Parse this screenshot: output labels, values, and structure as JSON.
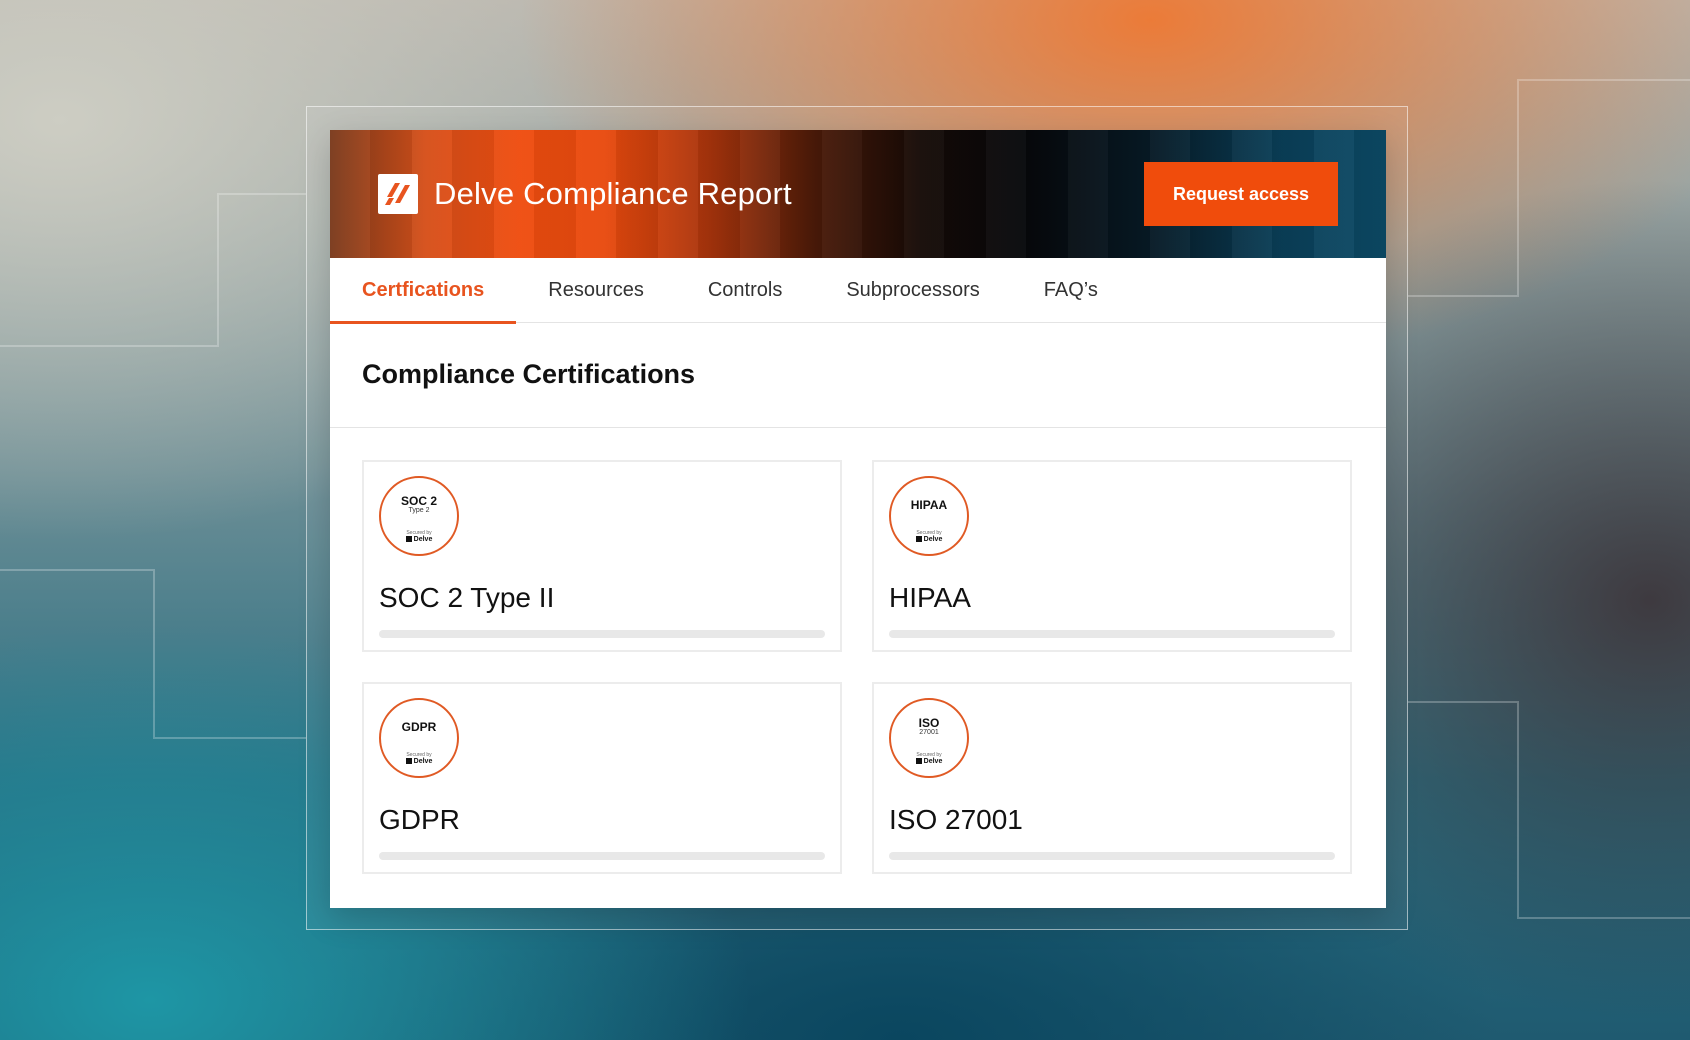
{
  "header": {
    "title": "Delve Compliance Report",
    "request_button": "Request access",
    "logo_icon": "delve-logo-icon"
  },
  "tabs": [
    {
      "label": "Certfications",
      "active": true
    },
    {
      "label": "Resources",
      "active": false
    },
    {
      "label": "Controls",
      "active": false
    },
    {
      "label": "Subprocessors",
      "active": false
    },
    {
      "label": "FAQ’s",
      "active": false
    }
  ],
  "section": {
    "title": "Compliance Certifications"
  },
  "certifications": [
    {
      "name": "SOC 2 Type II",
      "badge_title": "SOC 2",
      "badge_sub": "Type 2",
      "secured_by": "Secured by",
      "brand": "Delve"
    },
    {
      "name": "HIPAA",
      "badge_title": "HIPAA",
      "badge_sub": "",
      "secured_by": "Secured by",
      "brand": "Delve"
    },
    {
      "name": "GDPR",
      "badge_title": "GDPR",
      "badge_sub": "",
      "secured_by": "Secured by",
      "brand": "Delve"
    },
    {
      "name": "ISO 27001",
      "badge_title": "ISO",
      "badge_sub": "27001",
      "secured_by": "Secured by",
      "brand": "Delve"
    }
  ],
  "colors": {
    "accent": "#f04c0c",
    "tab_active": "#e8541f",
    "badge_ring": "#e05a24"
  }
}
